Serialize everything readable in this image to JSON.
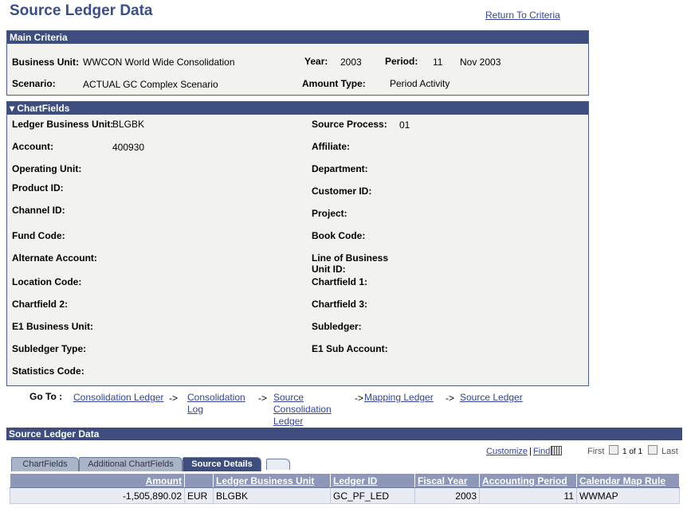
{
  "page": {
    "title": "Source Ledger Data",
    "return_link": "Return To Criteria"
  },
  "main_criteria": {
    "header": "Main Criteria",
    "business_unit_label": "Business Unit:",
    "business_unit_value": "WWCON World Wide Consolidation",
    "year_label": "Year:",
    "year_value": "2003",
    "period_label": "Period:",
    "period_value": "11",
    "period_desc": "Nov 2003",
    "scenario_label": "Scenario:",
    "scenario_value": "ACTUAL GC Complex Scenario",
    "amount_type_label": "Amount Type:",
    "amount_type_value": "Period Activity"
  },
  "chartfields": {
    "header": "▾ ChartFields",
    "ledger_bu_label": "Ledger Business Unit:",
    "ledger_bu_value": "BLGBK",
    "source_process_label": "Source Process:",
    "source_process_value": "01",
    "account_label": "Account:",
    "account_value": "400930",
    "affiliate_label": "Affiliate:",
    "operating_unit_label": "Operating Unit:",
    "department_label": "Department:",
    "product_id_label": "Product ID:",
    "customer_id_label": "Customer ID:",
    "channel_id_label": "Channel ID:",
    "project_label": "Project:",
    "fund_code_label": "Fund Code:",
    "book_code_label": "Book Code:",
    "alternate_account_label": "Alternate Account:",
    "lob_label_1": "Line of Business",
    "lob_label_2": "Unit ID:",
    "location_code_label": "Location Code:",
    "chartfield1_label": "Chartfield 1:",
    "chartfield2_label": "Chartfield 2:",
    "chartfield3_label": "Chartfield 3:",
    "e1_bu_label": "E1 Business Unit:",
    "subledger_label": "Subledger:",
    "subledger_type_label": "Subledger Type:",
    "e1_sub_account_label": "E1 Sub Account:",
    "statistics_code_label": "Statistics Code:"
  },
  "goto": {
    "label": "Go To :",
    "consolidation_ledger": "Consolidation Ledger",
    "consolidation_log_1": "Consolidation",
    "consolidation_log_2": "Log",
    "source_consolidation_1": "Source",
    "source_consolidation_2": "Consolidation",
    "source_consolidation_3": "Ledger",
    "mapping_ledger": "Mapping Ledger",
    "source_ledger": "Source Ledger",
    "arrow": "->"
  },
  "grid": {
    "title": "Source Ledger Data",
    "customize": "Customize",
    "find": "Find",
    "separator": "|",
    "first": "First",
    "range": "1 of 1",
    "last": "Last",
    "tabs": [
      "ChartFields",
      "Additional ChartFields",
      "Source Details"
    ],
    "columns": [
      "Amount",
      "",
      "Ledger Business Unit",
      "Ledger ID",
      "Fiscal Year",
      "Accounting Period",
      "Calendar Map Rule"
    ],
    "row": {
      "amount": "-1,505,890.02",
      "currency": "EUR",
      "ledger_bu": "BLGBK",
      "ledger_id": "GC_PF_LED",
      "fiscal_year": "2003",
      "accounting_period": "11",
      "calendar_map_rule": "WWMAP"
    }
  }
}
